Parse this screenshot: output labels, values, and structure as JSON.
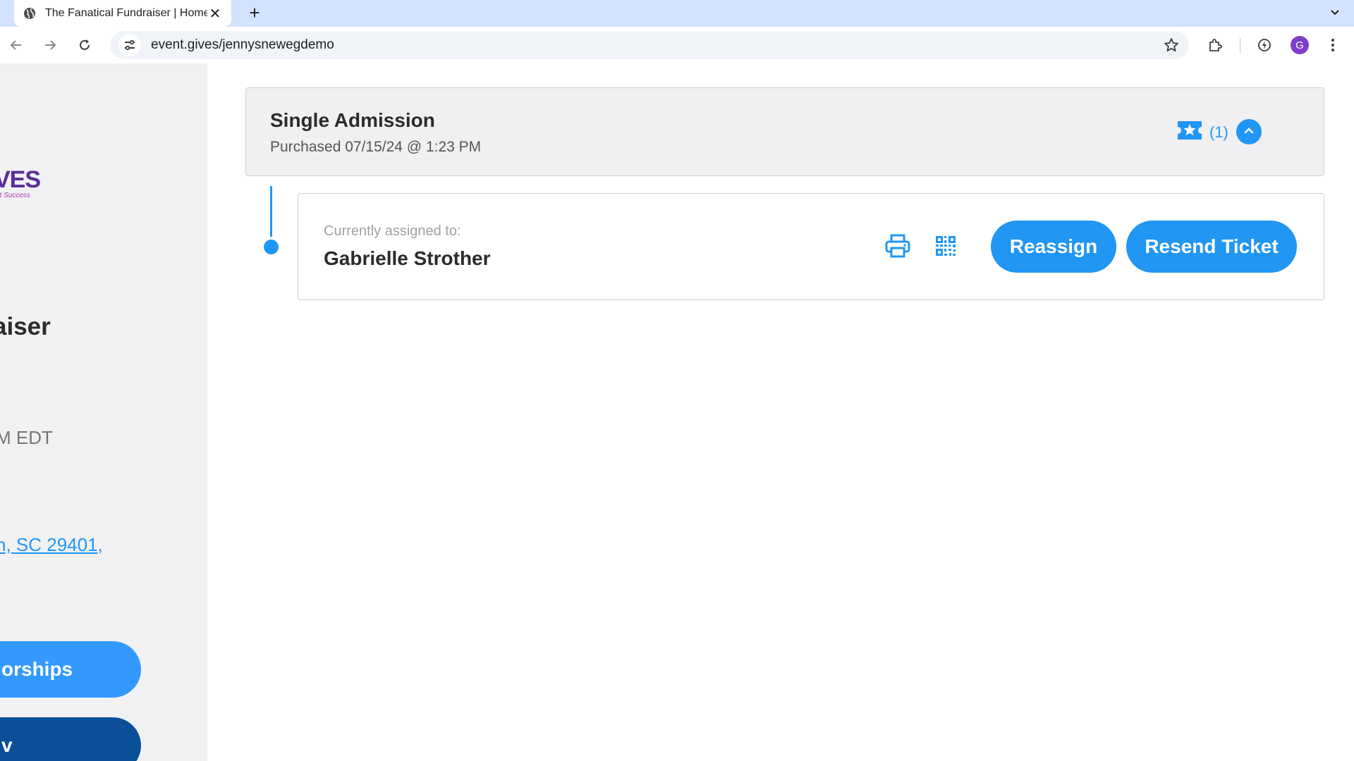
{
  "browser": {
    "tab_title": "The Fanatical Fundraiser | Home",
    "url": "event.gives/jennysnewegdemo",
    "profile_initial": "G"
  },
  "sidebar": {
    "logo_text": "VES",
    "logo_tagline": "nt Success",
    "event_title": "aiser",
    "event_time": "M EDT",
    "event_address": "n, SC 29401,",
    "sponsorships_label": "orships",
    "donate_label": "v"
  },
  "ticket": {
    "name": "Single Admission",
    "purchased": "Purchased 07/15/24 @ 1:23 PM",
    "count": "(1)",
    "assigned_label": "Currently assigned to:",
    "assigned_name": "Gabrielle Strother",
    "reassign_label": "Reassign",
    "resend_label": "Resend Ticket"
  },
  "colors": {
    "accent": "#2196f3",
    "sidebar_bg": "#f1f1f3",
    "donate_button": "#0a4f97",
    "brand_purple": "#5a2d9c"
  },
  "icons": [
    "globe-icon",
    "close-icon",
    "plus-icon",
    "chevron-down-icon",
    "back-arrow-icon",
    "forward-arrow-icon",
    "reload-icon",
    "site-settings-icon",
    "star-icon",
    "extensions-icon",
    "performance-icon",
    "kebab-menu-icon",
    "ticket-star-icon",
    "chevron-up-icon",
    "printer-icon",
    "qr-code-icon"
  ]
}
